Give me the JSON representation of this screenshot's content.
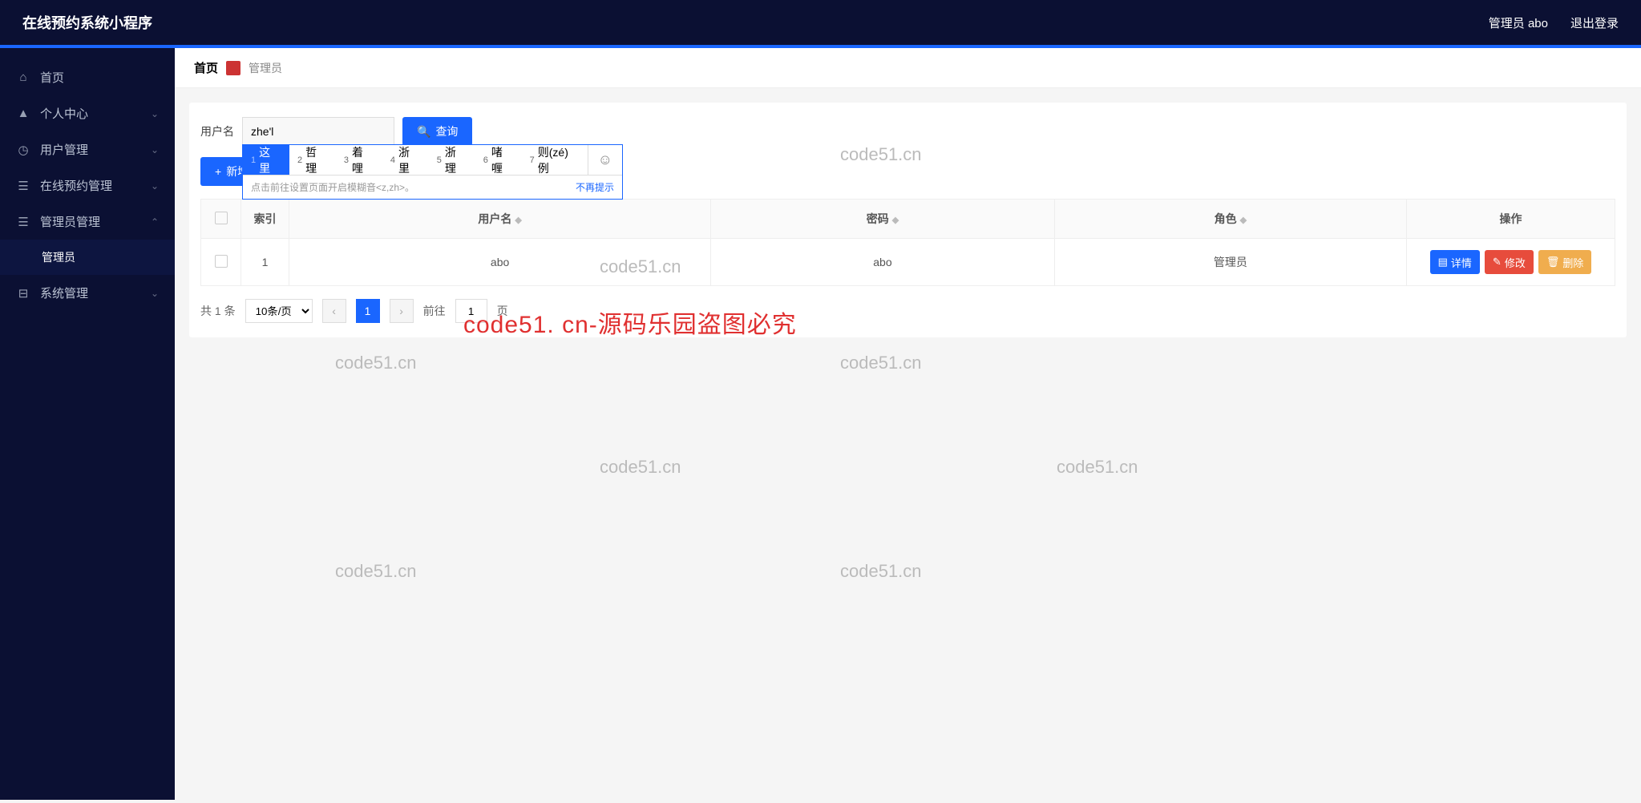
{
  "header": {
    "title": "在线预约系统小程序",
    "admin_label": "管理员 abo",
    "logout_label": "退出登录"
  },
  "sidebar": {
    "items": [
      {
        "icon": "home",
        "label": "首页",
        "has_chev": false
      },
      {
        "icon": "user",
        "label": "个人中心",
        "has_chev": true
      },
      {
        "icon": "users",
        "label": "用户管理",
        "has_chev": true
      },
      {
        "icon": "list",
        "label": "在线预约管理",
        "has_chev": true
      },
      {
        "icon": "list",
        "label": "管理员管理",
        "has_chev": true,
        "expanded": true
      },
      {
        "icon": "msg",
        "label": "系统管理",
        "has_chev": true
      }
    ],
    "sub_item": "管理员"
  },
  "breadcrumb": {
    "home": "首页",
    "current": "管理员"
  },
  "search": {
    "label": "用户名",
    "value": "zhe'l",
    "query_btn": "查询",
    "add_btn": "新增"
  },
  "ime": {
    "candidates": [
      {
        "n": "1",
        "t": "这里"
      },
      {
        "n": "2",
        "t": "哲理"
      },
      {
        "n": "3",
        "t": "着哩"
      },
      {
        "n": "4",
        "t": "浙里"
      },
      {
        "n": "5",
        "t": "浙理"
      },
      {
        "n": "6",
        "t": "啫喱"
      },
      {
        "n": "7",
        "t": "则(zé)例"
      }
    ],
    "tip": "点击前往设置页面开启模糊音<z,zh>。",
    "dismiss": "不再提示"
  },
  "table": {
    "headers": {
      "index": "索引",
      "username": "用户名",
      "password": "密码",
      "role": "角色",
      "ops": "操作"
    },
    "rows": [
      {
        "index": "1",
        "username": "abo",
        "password": "abo",
        "role": "管理员"
      }
    ],
    "ops": {
      "detail": "详情",
      "edit": "修改",
      "delete": "删除"
    }
  },
  "pager": {
    "total": "共 1 条",
    "size": "10条/页",
    "current": "1",
    "goto_pre": "前往",
    "goto_val": "1",
    "goto_suf": "页"
  },
  "watermarks": {
    "text": "code51.cn",
    "red": "code51. cn-源码乐园盗图必究"
  }
}
